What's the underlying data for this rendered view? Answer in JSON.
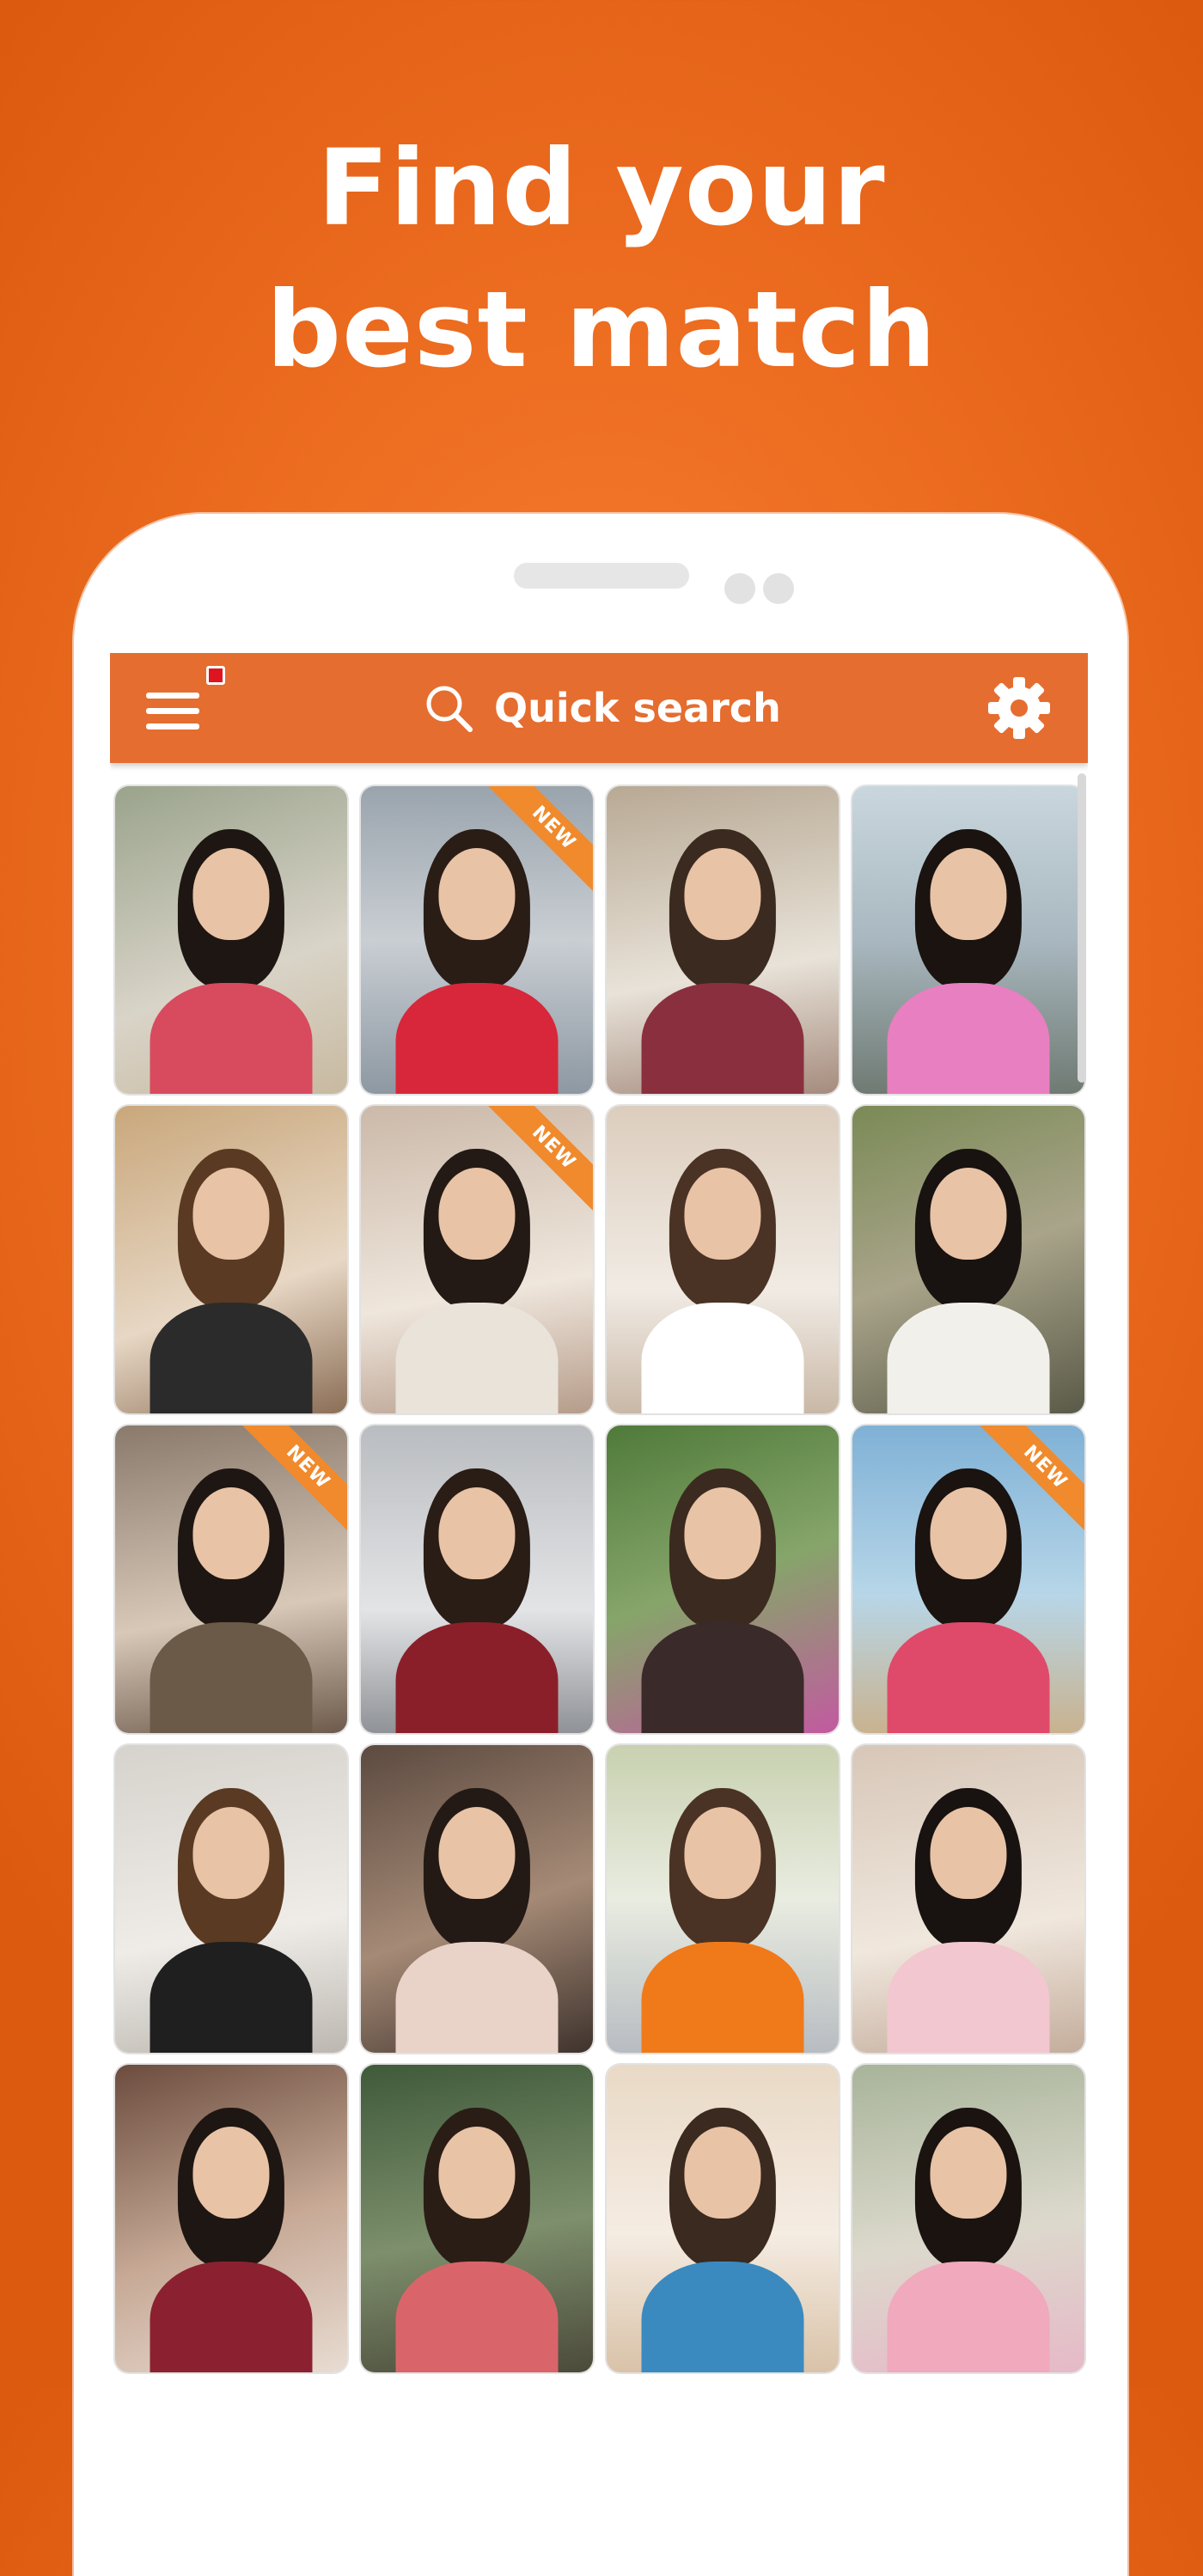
{
  "headline": {
    "line1": "Find your",
    "line2": "best match"
  },
  "appbar": {
    "search_label": "Quick search",
    "icons": {
      "menu": "hamburger-menu-icon",
      "notification": "notification-dot",
      "search": "search-icon",
      "settings": "gear-icon"
    }
  },
  "badge_text": "NEW",
  "colors": {
    "background_orange": "#ee6e22",
    "appbar": "#e56d2f",
    "badge": "#f08a2c",
    "notification_dot": "#e0141e"
  },
  "profiles": [
    {
      "new": false
    },
    {
      "new": true
    },
    {
      "new": false
    },
    {
      "new": false
    },
    {
      "new": false
    },
    {
      "new": true
    },
    {
      "new": false
    },
    {
      "new": false
    },
    {
      "new": true
    },
    {
      "new": false
    },
    {
      "new": false
    },
    {
      "new": true
    },
    {
      "new": false
    },
    {
      "new": false
    },
    {
      "new": false
    },
    {
      "new": false
    },
    {
      "new": false
    },
    {
      "new": false
    },
    {
      "new": false
    },
    {
      "new": false
    }
  ]
}
